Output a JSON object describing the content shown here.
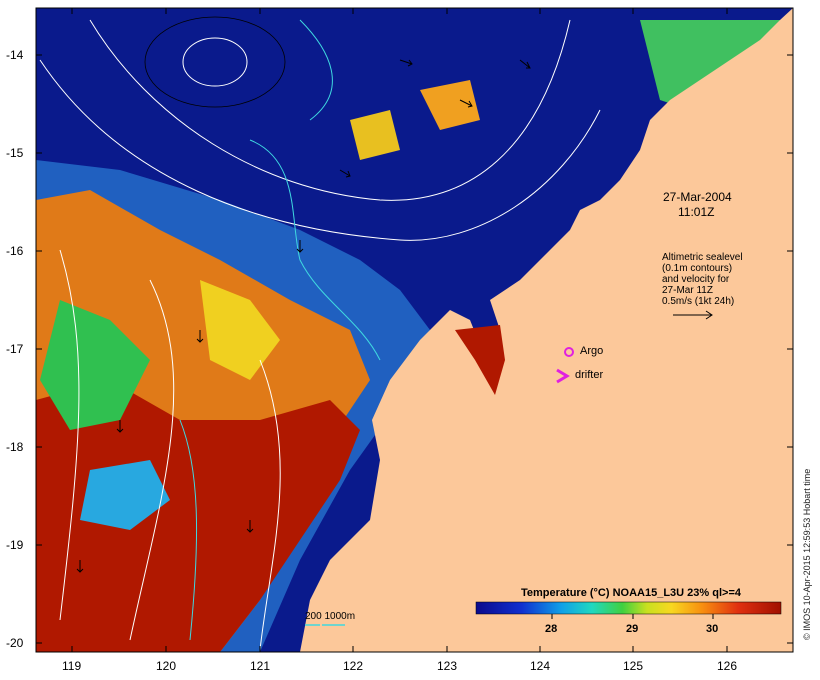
{
  "map": {
    "date_label": "27-Mar-2004",
    "time_label": "11:01Z",
    "altimetry_lines": [
      "Altimetric sealevel",
      "(0.1m contours)",
      "and velocity for",
      "27-Mar 11Z",
      "0.5m/s (1kt 24h)"
    ],
    "argo_label": "Argo",
    "drifter_label": "drifter",
    "bathymetry_label": "200  1000m",
    "colorbar_title": "Temperature (°C) NOAA15_L3U 23% ql>=4",
    "colorbar_ticks": [
      "28",
      "29",
      "30"
    ],
    "stamp": "© IMOS 10-Apr-2015 12:59:53 Hobart time",
    "lat_ticks": [
      "-14",
      "-15",
      "-16",
      "-17",
      "-18",
      "-19",
      "-20"
    ],
    "lon_ticks": [
      "119",
      "120",
      "121",
      "122",
      "123",
      "124",
      "125",
      "126"
    ],
    "colors": {
      "land": "#fcc89a",
      "cold": "#0a1a8c",
      "warm": "#a01200",
      "contour": "#ffffff",
      "bathy": "#3fd8e0",
      "argo": "#e020e0"
    }
  }
}
